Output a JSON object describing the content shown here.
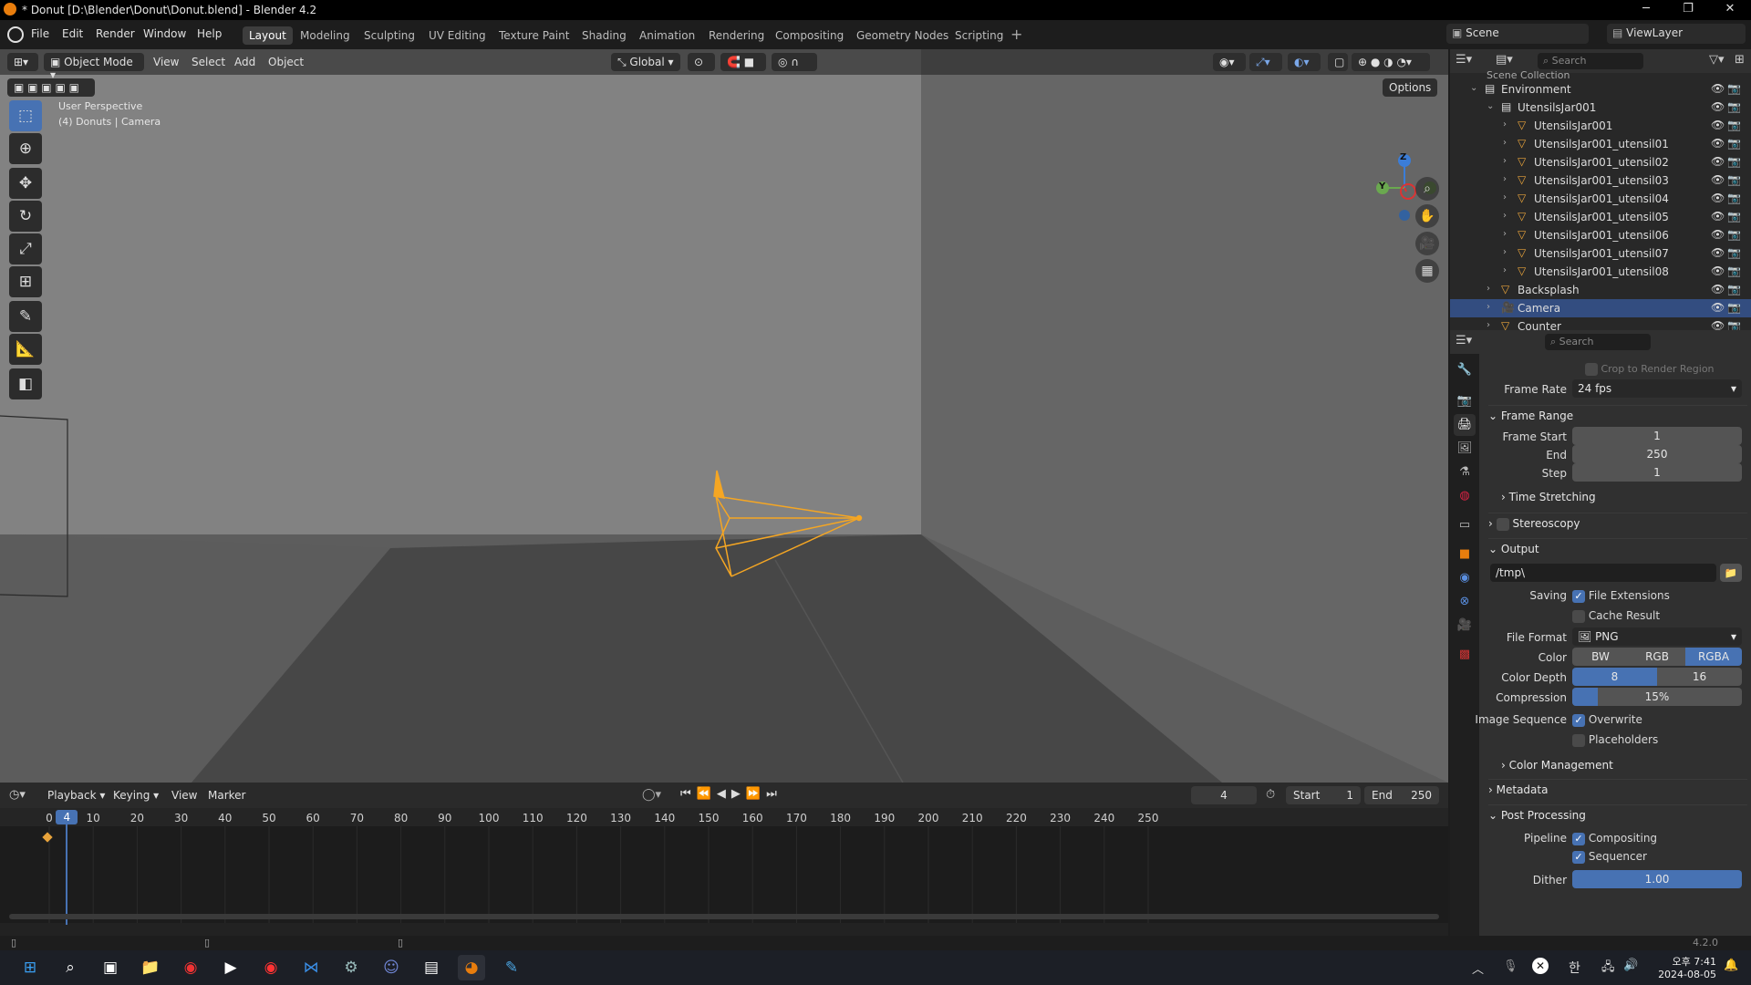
{
  "window": {
    "title": "* Donut [D:\\Blender\\Donut\\Donut.blend] - Blender 4.2",
    "min": "─",
    "max": "❐",
    "close": "✕"
  },
  "menu": [
    "File",
    "Edit",
    "Render",
    "Window",
    "Help"
  ],
  "workspaces": [
    "Layout",
    "Modeling",
    "Sculpting",
    "UV Editing",
    "Texture Paint",
    "Shading",
    "Animation",
    "Rendering",
    "Compositing",
    "Geometry Nodes",
    "Scripting"
  ],
  "active_workspace": "Layout",
  "scene": "Scene",
  "view_layer": "ViewLayer",
  "viewport": {
    "mode": "Object Mode",
    "menus": [
      "View",
      "Select",
      "Add",
      "Object"
    ],
    "orientation": "Global",
    "options": "Options",
    "perspective": "User Perspective",
    "context": "(4) Donuts | Camera",
    "gizmo": {
      "z": "Z",
      "y": "Y"
    }
  },
  "outliner": {
    "search_placeholder": "Search",
    "top_cut": "Scene Collection",
    "rows": [
      {
        "label": "Environment",
        "depth": 0,
        "type": "collection"
      },
      {
        "label": "UtensilsJar001",
        "depth": 1,
        "type": "collection"
      },
      {
        "label": "UtensilsJar001",
        "depth": 2,
        "type": "mesh"
      },
      {
        "label": "UtensilsJar001_utensil01",
        "depth": 2,
        "type": "mesh"
      },
      {
        "label": "UtensilsJar001_utensil02",
        "depth": 2,
        "type": "mesh"
      },
      {
        "label": "UtensilsJar001_utensil03",
        "depth": 2,
        "type": "mesh"
      },
      {
        "label": "UtensilsJar001_utensil04",
        "depth": 2,
        "type": "mesh"
      },
      {
        "label": "UtensilsJar001_utensil05",
        "depth": 2,
        "type": "mesh"
      },
      {
        "label": "UtensilsJar001_utensil06",
        "depth": 2,
        "type": "mesh"
      },
      {
        "label": "UtensilsJar001_utensil07",
        "depth": 2,
        "type": "mesh"
      },
      {
        "label": "UtensilsJar001_utensil08",
        "depth": 2,
        "type": "mesh"
      },
      {
        "label": "Backsplash",
        "depth": 1,
        "type": "mesh"
      },
      {
        "label": "Camera",
        "depth": 1,
        "type": "camera",
        "selected": true
      },
      {
        "label": "Counter",
        "depth": 1,
        "type": "mesh"
      }
    ]
  },
  "properties": {
    "search_placeholder": "Search",
    "crop": "Crop to Render Region",
    "frame_rate_label": "Frame Rate",
    "frame_rate": "24 fps",
    "frame_range": "Frame Range",
    "frame_start_label": "Frame Start",
    "frame_start": "1",
    "end_label": "End",
    "end": "250",
    "step_label": "Step",
    "step": "1",
    "time_stretching": "Time Stretching",
    "stereoscopy": "Stereoscopy",
    "output": "Output",
    "path": "/tmp\\",
    "saving_label": "Saving",
    "file_extensions": "File Extensions",
    "cache_result": "Cache Result",
    "file_format_label": "File Format",
    "file_format": "PNG",
    "color_label": "Color",
    "color_opts": [
      "BW",
      "RGB",
      "RGBA"
    ],
    "color_depth_label": "Color Depth",
    "depth_opts": [
      "8",
      "16"
    ],
    "compression_label": "Compression",
    "compression": "15%",
    "compression_fraction": 0.15,
    "image_sequence_label": "Image Sequence",
    "overwrite": "Overwrite",
    "placeholders": "Placeholders",
    "color_management": "Color Management",
    "metadata": "Metadata",
    "post_processing": "Post Processing",
    "pipeline_label": "Pipeline",
    "compositing": "Compositing",
    "sequencer": "Sequencer",
    "dither_label": "Dither",
    "dither": "1.00"
  },
  "timeline": {
    "menus": [
      "Playback",
      "Keying",
      "View",
      "Marker"
    ],
    "current_frame": "4",
    "start_label": "Start",
    "start": "1",
    "end_label": "End",
    "end": "250",
    "ticks": [
      "0",
      "10",
      "20",
      "30",
      "40",
      "50",
      "60",
      "70",
      "80",
      "90",
      "100",
      "110",
      "120",
      "130",
      "140",
      "150",
      "160",
      "170",
      "180",
      "190",
      "200",
      "210",
      "220",
      "230",
      "240",
      "250"
    ],
    "playhead": "4"
  },
  "status": {
    "version": "4.2.0"
  },
  "taskbar": {
    "ime": "한",
    "time": "오후 7:41",
    "date": "2024-08-05",
    "apps": [
      "windows-start",
      "search",
      "task-view",
      "file-explorer",
      "chrome",
      "media-player",
      "youtube-music",
      "visual-studio",
      "steam",
      "discord",
      "terminal",
      "blender",
      "paint"
    ]
  }
}
